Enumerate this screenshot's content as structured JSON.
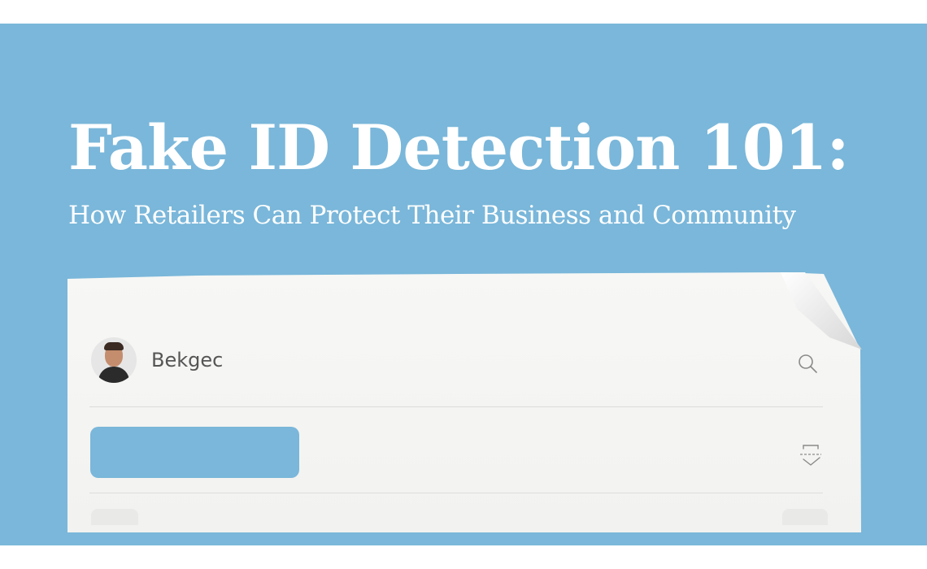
{
  "hero": {
    "title": "Fake ID Detection 101:",
    "subtitle": "How Retailers Can Protect Their Business and Community"
  },
  "card": {
    "user_name": "Bekgec",
    "icons": [
      "avatar",
      "search-icon",
      "id-scan-icon"
    ]
  },
  "colors": {
    "background": "#7ab7da",
    "accent": "#7ab7da",
    "paper": "#f4f4f2",
    "title_text": "#ffffff"
  }
}
